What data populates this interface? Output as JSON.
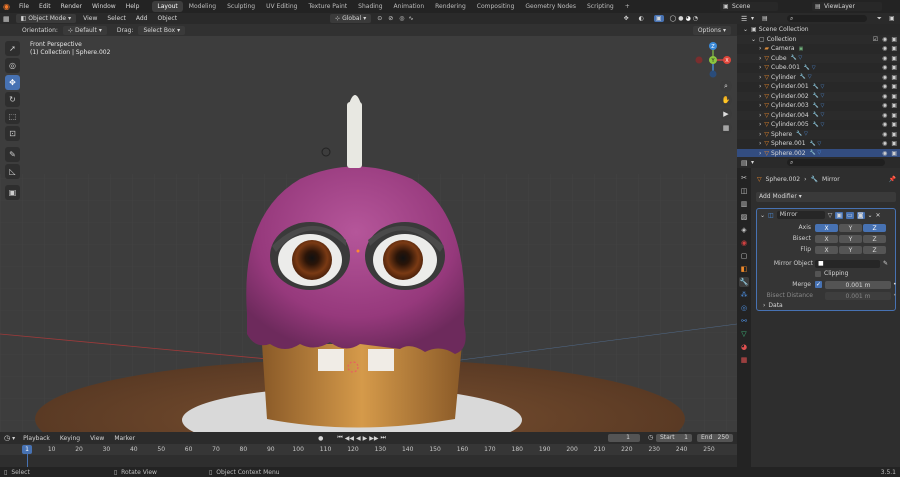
{
  "menu": [
    "File",
    "Edit",
    "Render",
    "Window",
    "Help"
  ],
  "workspaces": [
    {
      "label": "Layout",
      "active": true
    },
    {
      "label": "Modeling"
    },
    {
      "label": "Sculpting"
    },
    {
      "label": "UV Editing"
    },
    {
      "label": "Texture Paint"
    },
    {
      "label": "Shading"
    },
    {
      "label": "Animation"
    },
    {
      "label": "Rendering"
    },
    {
      "label": "Compositing"
    },
    {
      "label": "Geometry Nodes"
    },
    {
      "label": "Scripting"
    }
  ],
  "workspace_add": "+",
  "scene": "Scene",
  "view_layer": "ViewLayer",
  "viewport_header": {
    "mode": "Object Mode",
    "menus": [
      "View",
      "Select",
      "Add",
      "Object"
    ],
    "transform_orientation": "Global"
  },
  "tool_settings": {
    "orientation_label": "Orientation:",
    "orientation_value": "Default",
    "drag_label": "Drag:",
    "drag_value": "Select Box",
    "options": "Options"
  },
  "viewport_info": {
    "view_name": "Front Perspective",
    "collection_line": "(1) Collection | Sphere.002"
  },
  "outliner": {
    "items": [
      {
        "label": "Scene Collection",
        "type": "scene"
      },
      {
        "label": "Collection",
        "type": "collection"
      },
      {
        "label": "Camera",
        "type": "camera"
      },
      {
        "label": "Cube",
        "type": "mesh"
      },
      {
        "label": "Cube.001",
        "type": "mesh"
      },
      {
        "label": "Cylinder",
        "type": "mesh"
      },
      {
        "label": "Cylinder.001",
        "type": "mesh"
      },
      {
        "label": "Cylinder.002",
        "type": "mesh"
      },
      {
        "label": "Cylinder.003",
        "type": "mesh"
      },
      {
        "label": "Cylinder.004",
        "type": "mesh"
      },
      {
        "label": "Cylinder.005",
        "type": "mesh"
      },
      {
        "label": "Sphere",
        "type": "mesh"
      },
      {
        "label": "Sphere.001",
        "type": "mesh"
      },
      {
        "label": "Sphere.002",
        "type": "mesh"
      }
    ]
  },
  "properties": {
    "breadcrumb_object": "Sphere.002",
    "breadcrumb_modifier": "Mirror",
    "add_modifier": "Add Modifier",
    "modifier_name": "Mirror",
    "axis_label": "Axis",
    "bisect_label": "Bisect",
    "flip_label": "Flip",
    "axes": [
      "X",
      "Y",
      "Z"
    ],
    "axis_on": [
      true,
      false,
      true
    ],
    "mirror_object_label": "Mirror Object",
    "clipping_label": "Clipping",
    "merge_label": "Merge",
    "merge_value": "0.001 m",
    "bisect_distance_label": "Bisect Distance",
    "bisect_distance_value": "0.001 m",
    "data_label": "Data"
  },
  "timeline": {
    "menus": [
      "Playback",
      "Keying",
      "View",
      "Marker"
    ],
    "current_frame": "1",
    "start_label": "Start",
    "start_value": "1",
    "end_label": "End",
    "end_value": "250",
    "ticks": [
      "1",
      "10",
      "20",
      "30",
      "40",
      "50",
      "60",
      "70",
      "80",
      "90",
      "100",
      "110",
      "120",
      "130",
      "140",
      "150",
      "160",
      "170",
      "180",
      "190",
      "200",
      "210",
      "220",
      "230",
      "240",
      "250"
    ]
  },
  "status": {
    "select": "Select",
    "rotate": "Rotate View",
    "context": "Object Context Menu",
    "version": "3.5.1"
  },
  "colors": {
    "accent": "#4772b3",
    "viewport_bg": "#3d3d3d",
    "frosting": "#a04585",
    "cake": "#c98a40"
  }
}
